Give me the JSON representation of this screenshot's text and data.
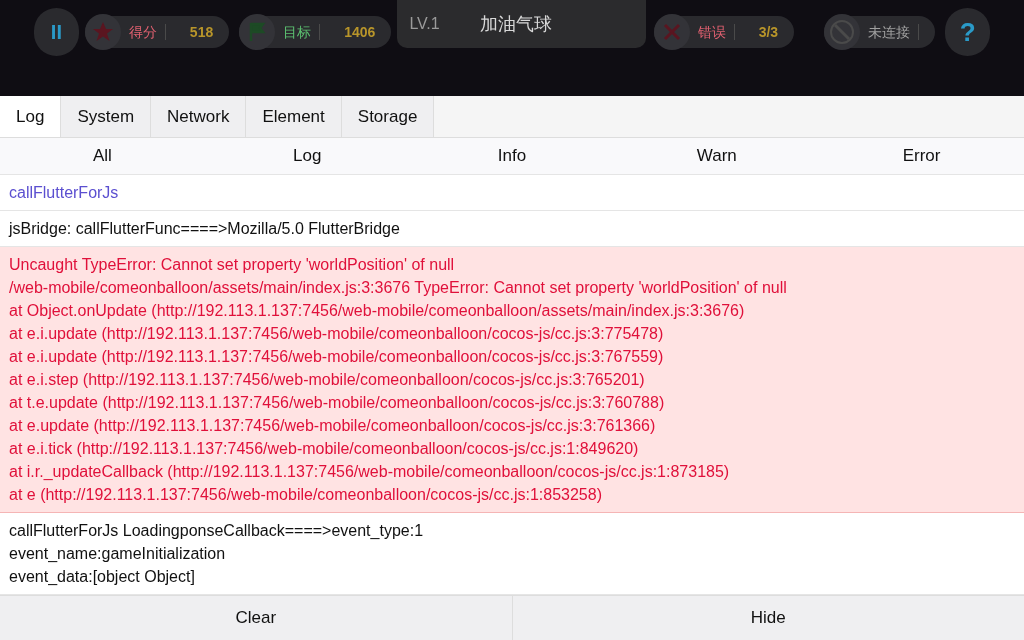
{
  "game_hud": {
    "pause_label": "II",
    "score": {
      "label": "得分",
      "value": "518"
    },
    "target": {
      "label": "目标",
      "value": "1406"
    },
    "level_panel": {
      "level": "LV.1",
      "title": "加油气球"
    },
    "errors": {
      "label": "错误",
      "value": "3/3"
    },
    "connection": {
      "label": "未连接"
    },
    "help": "?"
  },
  "tabs": [
    {
      "label": "Log",
      "selected": true
    },
    {
      "label": "System",
      "selected": false
    },
    {
      "label": "Network",
      "selected": false
    },
    {
      "label": "Element",
      "selected": false
    },
    {
      "label": "Storage",
      "selected": false
    }
  ],
  "filters": [
    "All",
    "Log",
    "Info",
    "Warn",
    "Error"
  ],
  "entries": [
    {
      "kind": "info",
      "lines": [
        "callFlutterForJs"
      ]
    },
    {
      "kind": "log",
      "lines": [
        "jsBridge: callFlutterFunc====>Mozilla/5.0 FlutterBridge"
      ]
    },
    {
      "kind": "error",
      "lines": [
        "Uncaught TypeError: Cannot set property 'worldPosition' of null",
        "/web-mobile/comeonballoon/assets/main/index.js:3:3676 TypeError: Cannot set property 'worldPosition' of null",
        "at Object.onUpdate (http://192.113.1.137:7456/web-mobile/comeonballoon/assets/main/index.js:3:3676)",
        "at e.i.update (http://192.113.1.137:7456/web-mobile/comeonballoon/cocos-js/cc.js:3:775478)",
        "at e.i.update (http://192.113.1.137:7456/web-mobile/comeonballoon/cocos-js/cc.js:3:767559)",
        "at e.i.step (http://192.113.1.137:7456/web-mobile/comeonballoon/cocos-js/cc.js:3:765201)",
        "at t.e.update (http://192.113.1.137:7456/web-mobile/comeonballoon/cocos-js/cc.js:3:760788)",
        "at e.update (http://192.113.1.137:7456/web-mobile/comeonballoon/cocos-js/cc.js:3:761366)",
        "at e.i.tick (http://192.113.1.137:7456/web-mobile/comeonballoon/cocos-js/cc.js:1:849620)",
        "at i.r._updateCallback (http://192.113.1.137:7456/web-mobile/comeonballoon/cocos-js/cc.js:1:873185)",
        "at e (http://192.113.1.137:7456/web-mobile/comeonballoon/cocos-js/cc.js:1:853258)"
      ]
    },
    {
      "kind": "log",
      "lines": [
        "callFlutterForJs LoadingponseCallback====>event_type:1",
        "event_name:gameInitialization",
        "event_data:[object Object]"
      ]
    }
  ],
  "buttons": [
    "Clear",
    "Hide"
  ]
}
